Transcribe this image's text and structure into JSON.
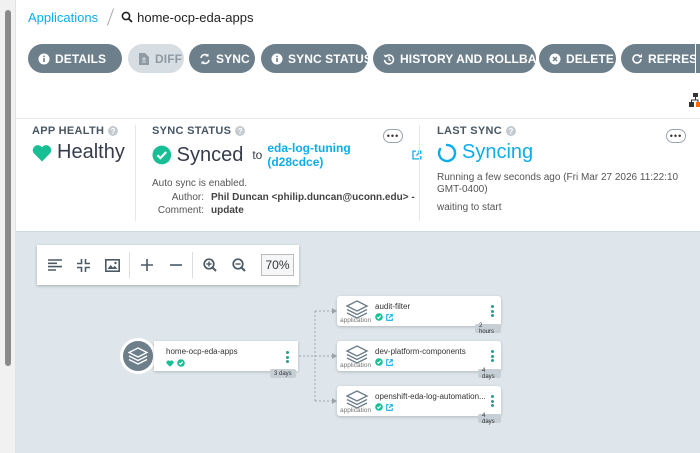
{
  "breadcrumb": {
    "applications": "Applications",
    "app_name": "home-ocp-eda-apps"
  },
  "actions": {
    "details": "DETAILS",
    "diff": "DIFF",
    "sync": "SYNC",
    "sync_status": "SYNC STATUS",
    "history": "HISTORY AND ROLLBACK",
    "delete": "DELETE",
    "refresh": "REFRESH"
  },
  "app_health": {
    "title": "APP HEALTH",
    "status": "Healthy",
    "color": "#18be94"
  },
  "sync_status": {
    "title": "SYNC STATUS",
    "status": "Synced",
    "to": "to",
    "revision": "eda-log-tuning (d28cdce)",
    "auto_sync": "Auto sync is enabled.",
    "author_label": "Author:",
    "author": "Phil Duncan <philip.duncan@uconn.edu> -",
    "comment_label": "Comment:",
    "comment": "update",
    "color": "#18be94"
  },
  "last_sync": {
    "title": "LAST SYNC",
    "status": "Syncing",
    "running": "Running a few seconds ago (Fri Mar 27 2026 11:22:10 GMT-0400)",
    "waiting": "waiting to start",
    "color": "#0dadea"
  },
  "graph_toolbar": {
    "zoom": "70%"
  },
  "tree": {
    "root": {
      "name": "home-ocp-eda-apps",
      "age": "3 days"
    },
    "children": [
      {
        "name": "audit-filter",
        "kind": "application",
        "age": "2 hours"
      },
      {
        "name": "dev-platform-components",
        "kind": "application",
        "age": "4 days"
      },
      {
        "name": "openshift-eda-log-automation...",
        "kind": "application",
        "age": "4 days"
      }
    ]
  }
}
